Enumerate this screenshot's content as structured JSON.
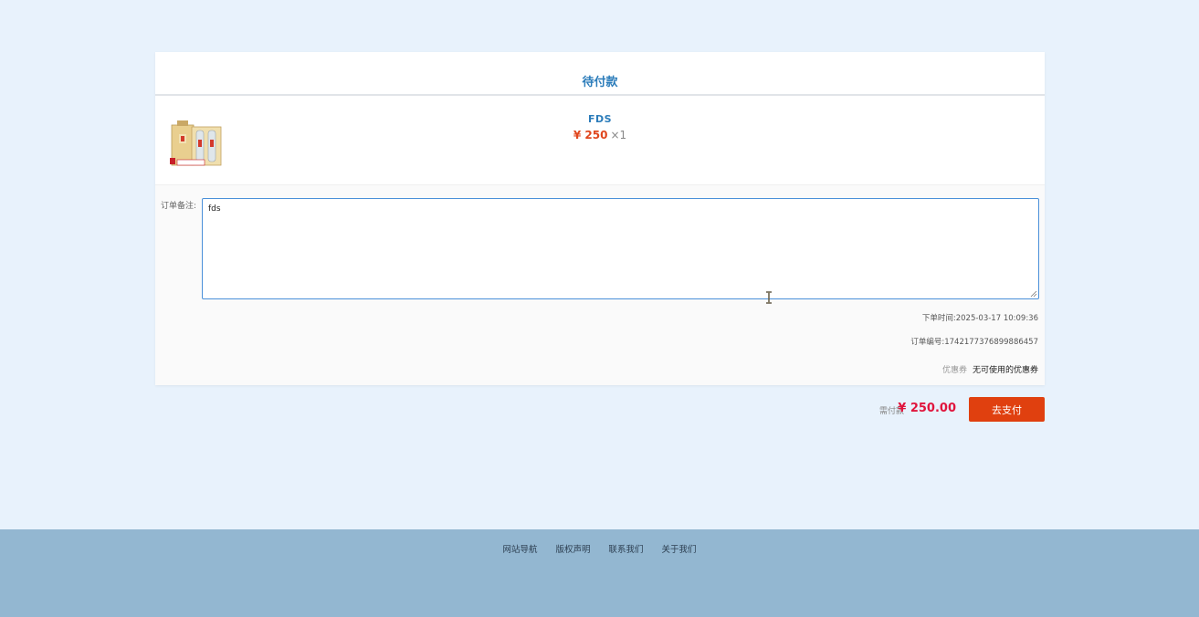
{
  "order": {
    "status_title": "待付款",
    "product": {
      "name": "FDS",
      "price": "¥ 250",
      "quantity": "×1"
    },
    "remark_label": "订单备注:",
    "remark_value": "fds",
    "order_time": "下单时间:2025-03-17 10:09:36",
    "order_number": "订单编号:1742177376899886457",
    "coupon_label": "优惠券",
    "coupon_value": "无可使用的优惠券"
  },
  "payment": {
    "due_label": "需付款",
    "due_amount": "¥ 250.00",
    "pay_button": "去支付"
  },
  "footer": {
    "links": [
      "网站导航",
      "版权声明",
      "联系我们",
      "关于我们"
    ]
  },
  "colors": {
    "page_bg": "#e8f2fc",
    "title_blue": "#2b7cba",
    "price_red": "#e0461d",
    "pay_button": "#e0400f",
    "footer_bg": "#93b7d1"
  },
  "icons": {
    "cursor": "text-cursor-icon",
    "resize": "resize-grip-icon"
  }
}
